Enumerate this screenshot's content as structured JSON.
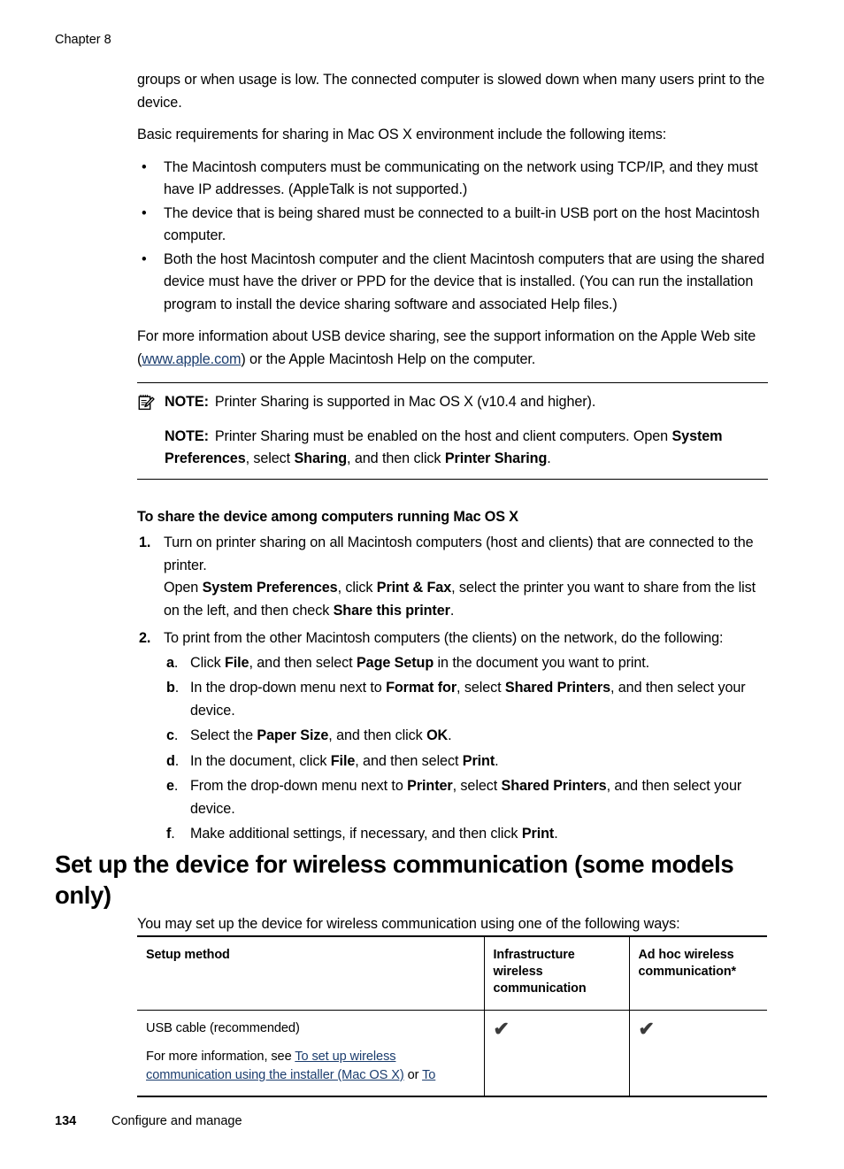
{
  "header": {
    "chapter": "Chapter 8"
  },
  "body": {
    "para1": "groups or when usage is low. The connected computer is slowed down when many users print to the device.",
    "para2": "Basic requirements for sharing in Mac OS X environment include the following items:",
    "bullets": [
      "The Macintosh computers must be communicating on the network using TCP/IP, and they must have IP addresses. (AppleTalk is not supported.)",
      "The device that is being shared must be connected to a built-in USB port on the host Macintosh computer.",
      "Both the host Macintosh computer and the client Macintosh computers that are using the shared device must have the driver or PPD for the device that is installed. (You can run the installation program to install the device sharing software and associated Help files.)"
    ],
    "para3_pre": "For more information about USB device sharing, see the support information on the Apple Web site (",
    "para3_link": "www.apple.com",
    "para3_post": ") or the Apple Macintosh Help on the computer."
  },
  "notes": {
    "icon": "note-pencil-icon",
    "label": "NOTE:",
    "note1": "Printer Sharing is supported in Mac OS X (v10.4 and higher).",
    "note2_p1": "Printer Sharing must be enabled on the host and client computers. Open ",
    "note2_b1": "System Preferences",
    "note2_p2": ", select ",
    "note2_b2": "Sharing",
    "note2_p3": ", and then click ",
    "note2_b3": "Printer Sharing",
    "note2_p4": "."
  },
  "procedure": {
    "heading": "To share the device among computers running Mac OS X",
    "steps": [
      {
        "num": "1.",
        "line1": "Turn on printer sharing on all Macintosh computers (host and clients) that are connected to the printer.",
        "line2_p1": "Open ",
        "line2_b1": "System Preferences",
        "line2_p2": ", click ",
        "line2_b2": "Print & Fax",
        "line2_p3": ", select the printer you want to share from the list on the left, and then check ",
        "line2_b3": "Share this printer",
        "line2_p4": "."
      },
      {
        "num": "2.",
        "line1": "To print from the other Macintosh computers (the clients) on the network, do the following:"
      }
    ],
    "substeps": [
      {
        "num": "a",
        "p1": "Click ",
        "b1": "File",
        "p2": ", and then select ",
        "b2": "Page Setup",
        "p3": " in the document you want to print.",
        "b3": "",
        "p4": ""
      },
      {
        "num": "b",
        "p1": "In the drop-down menu next to ",
        "b1": "Format for",
        "p2": ", select ",
        "b2": "Shared Printers",
        "p3": ", and then select your device.",
        "b3": "",
        "p4": ""
      },
      {
        "num": "c",
        "p1": "Select the ",
        "b1": "Paper Size",
        "p2": ", and then click ",
        "b2": "OK",
        "p3": ".",
        "b3": "",
        "p4": ""
      },
      {
        "num": "d",
        "p1": "In the document, click ",
        "b1": "File",
        "p2": ", and then select ",
        "b2": "Print",
        "p3": ".",
        "b3": "",
        "p4": ""
      },
      {
        "num": "e",
        "p1": "From the drop-down menu next to ",
        "b1": "Printer",
        "p2": ", select ",
        "b2": "Shared Printers",
        "p3": ", and then select your device.",
        "b3": "",
        "p4": ""
      },
      {
        "num": "f",
        "p1": "Make additional settings, if necessary, and then click ",
        "b1": "Print",
        "p2": ".",
        "b2": "",
        "p3": "",
        "b3": "",
        "p4": ""
      }
    ]
  },
  "section": {
    "heading": "Set up the device for wireless communication (some models only)",
    "intro": "You may set up the device for wireless communication using one of the following ways:"
  },
  "table": {
    "headers": {
      "method": "Setup method",
      "infrastructure": "Infrastructure wireless communication",
      "adhoc": "Ad hoc wireless communication*"
    },
    "rows": [
      {
        "method_line1": "USB cable (recommended)",
        "method_line2_pre": "For more information, see ",
        "method_line2_link1": "To set up wireless communication using the installer (Mac OS X)",
        "method_line2_mid": " or ",
        "method_line2_link2": "To",
        "infrastructure": "✔",
        "adhoc": "✔"
      }
    ]
  },
  "footer": {
    "page_number": "134",
    "section_title": "Configure and manage"
  },
  "colors": {
    "link": "#1b3d6e",
    "text": "#000000",
    "background": "#ffffff",
    "check": "#3b3b3b"
  }
}
